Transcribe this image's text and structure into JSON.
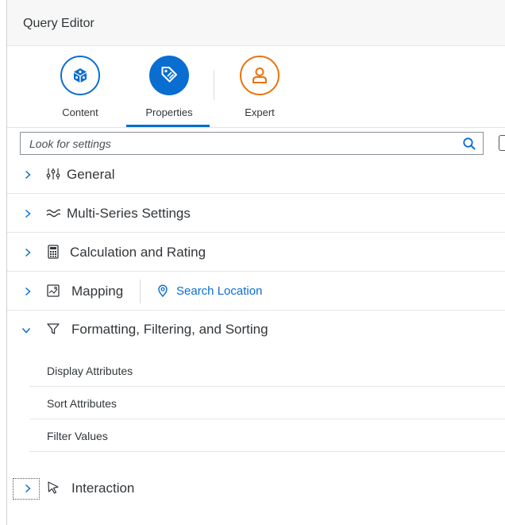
{
  "header": {
    "title": "Query Editor"
  },
  "tabs": [
    {
      "label": "Content",
      "icon": "cube-icon",
      "color": "#0a6ed1"
    },
    {
      "label": "Properties",
      "icon": "tag-icon",
      "color": "#0a6ed1",
      "selected": true
    },
    {
      "label": "Expert",
      "icon": "person-icon",
      "color": "#e9730c"
    }
  ],
  "search": {
    "placeholder": "Look for settings",
    "value": ""
  },
  "sections": [
    {
      "title": "General",
      "icon": "sliders-icon",
      "expanded": false
    },
    {
      "title": "Multi-Series Settings",
      "icon": "wave-icon",
      "expanded": false
    },
    {
      "title": "Calculation and Rating",
      "icon": "calculator-icon",
      "expanded": false
    },
    {
      "title": "Mapping",
      "icon": "map-icon",
      "expanded": false,
      "link": "Search Location"
    },
    {
      "title": "Formatting, Filtering, and Sorting",
      "icon": "filter-icon",
      "expanded": true,
      "items": [
        "Display Attributes",
        "Sort Attributes",
        "Filter Values"
      ]
    },
    {
      "title": "Interaction",
      "icon": "cursor-icon",
      "expanded": false
    }
  ],
  "colors": {
    "accent": "#0a6ed1",
    "expert": "#e9730c",
    "text": "#32363a"
  }
}
